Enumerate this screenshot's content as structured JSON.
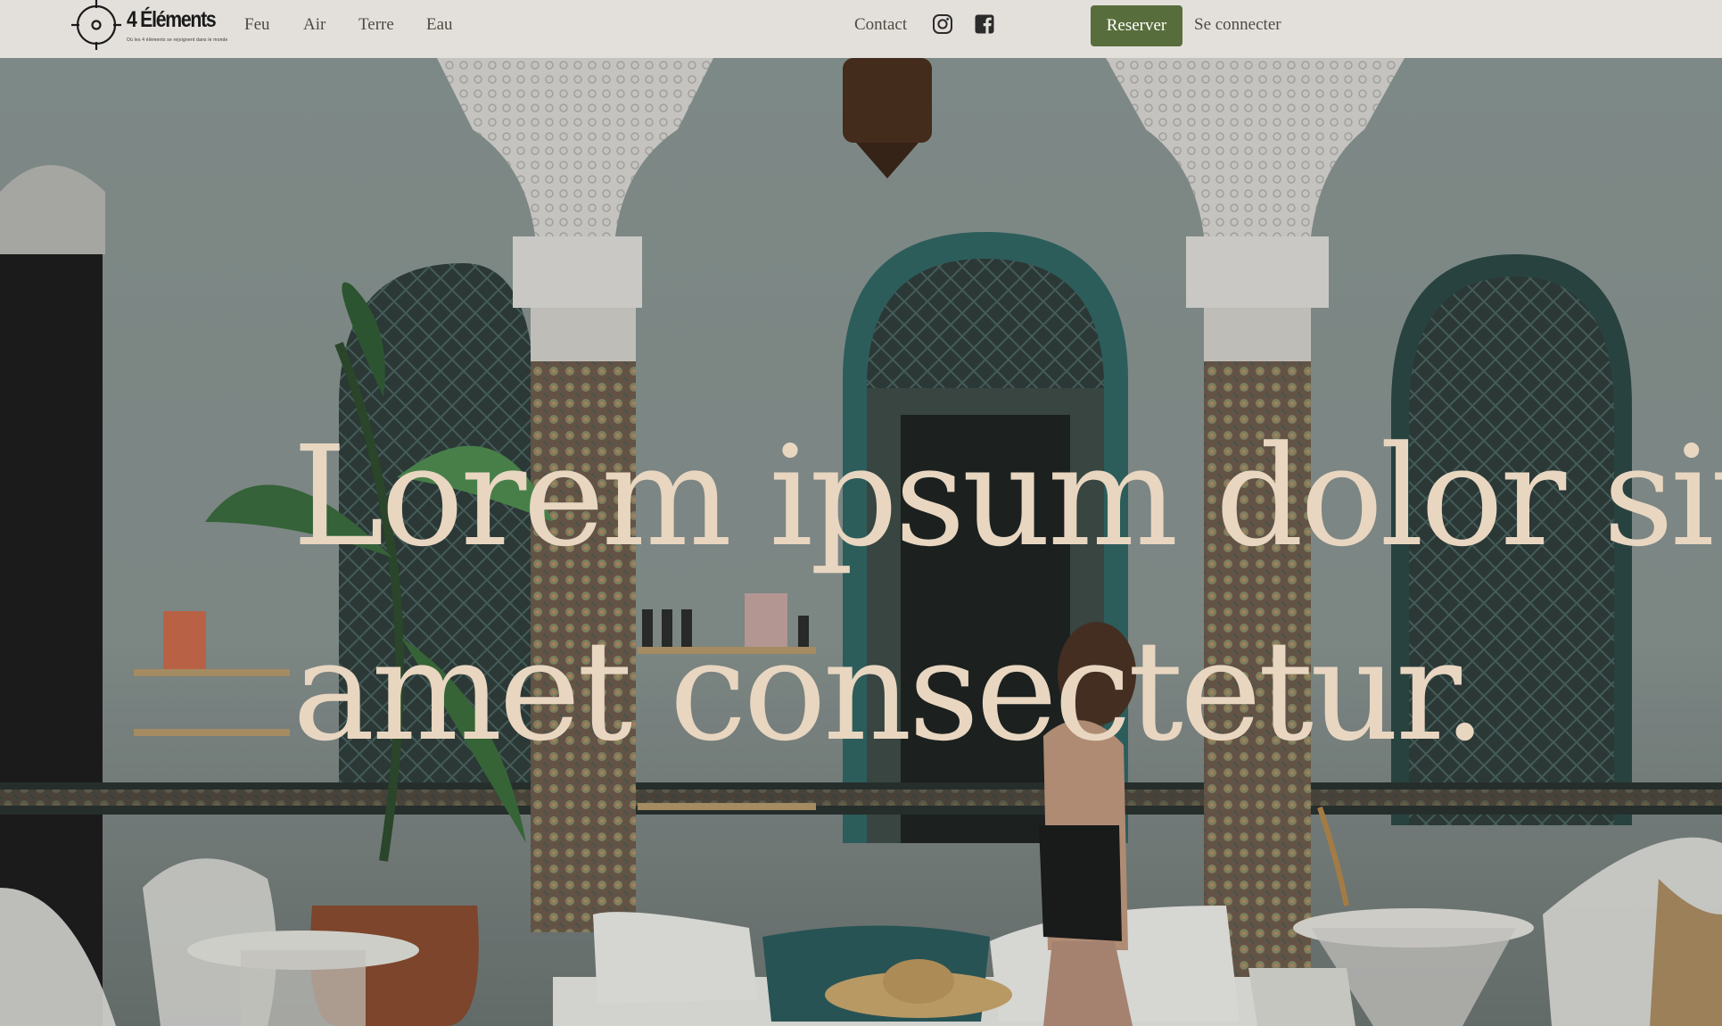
{
  "header": {
    "logo": {
      "name": "4 Éléments",
      "tagline": "Où les 4 éléments se rejoignent dans le monde",
      "icon": "crosshair-circle-icon"
    },
    "nav": [
      {
        "label": "Feu"
      },
      {
        "label": "Air"
      },
      {
        "label": "Terre"
      },
      {
        "label": "Eau"
      }
    ],
    "contact_label": "Contact",
    "social": [
      {
        "icon": "instagram-icon"
      },
      {
        "icon": "facebook-icon"
      }
    ],
    "reserve_label": "Reserver",
    "login_label": "Se connecter"
  },
  "hero": {
    "title": "Lorem ipsum dolor sit amet consectetur.",
    "background": "photo of a Moroccan riad courtyard with carved white columns, teal arched doors, potted plants, white wicker chairs, a daybed and a woman walking"
  },
  "colors": {
    "header_bg": "#e3e0dc",
    "nav_text": "#4f4a41",
    "accent": "#586d3c",
    "hero_title": "#e8d6c1"
  }
}
